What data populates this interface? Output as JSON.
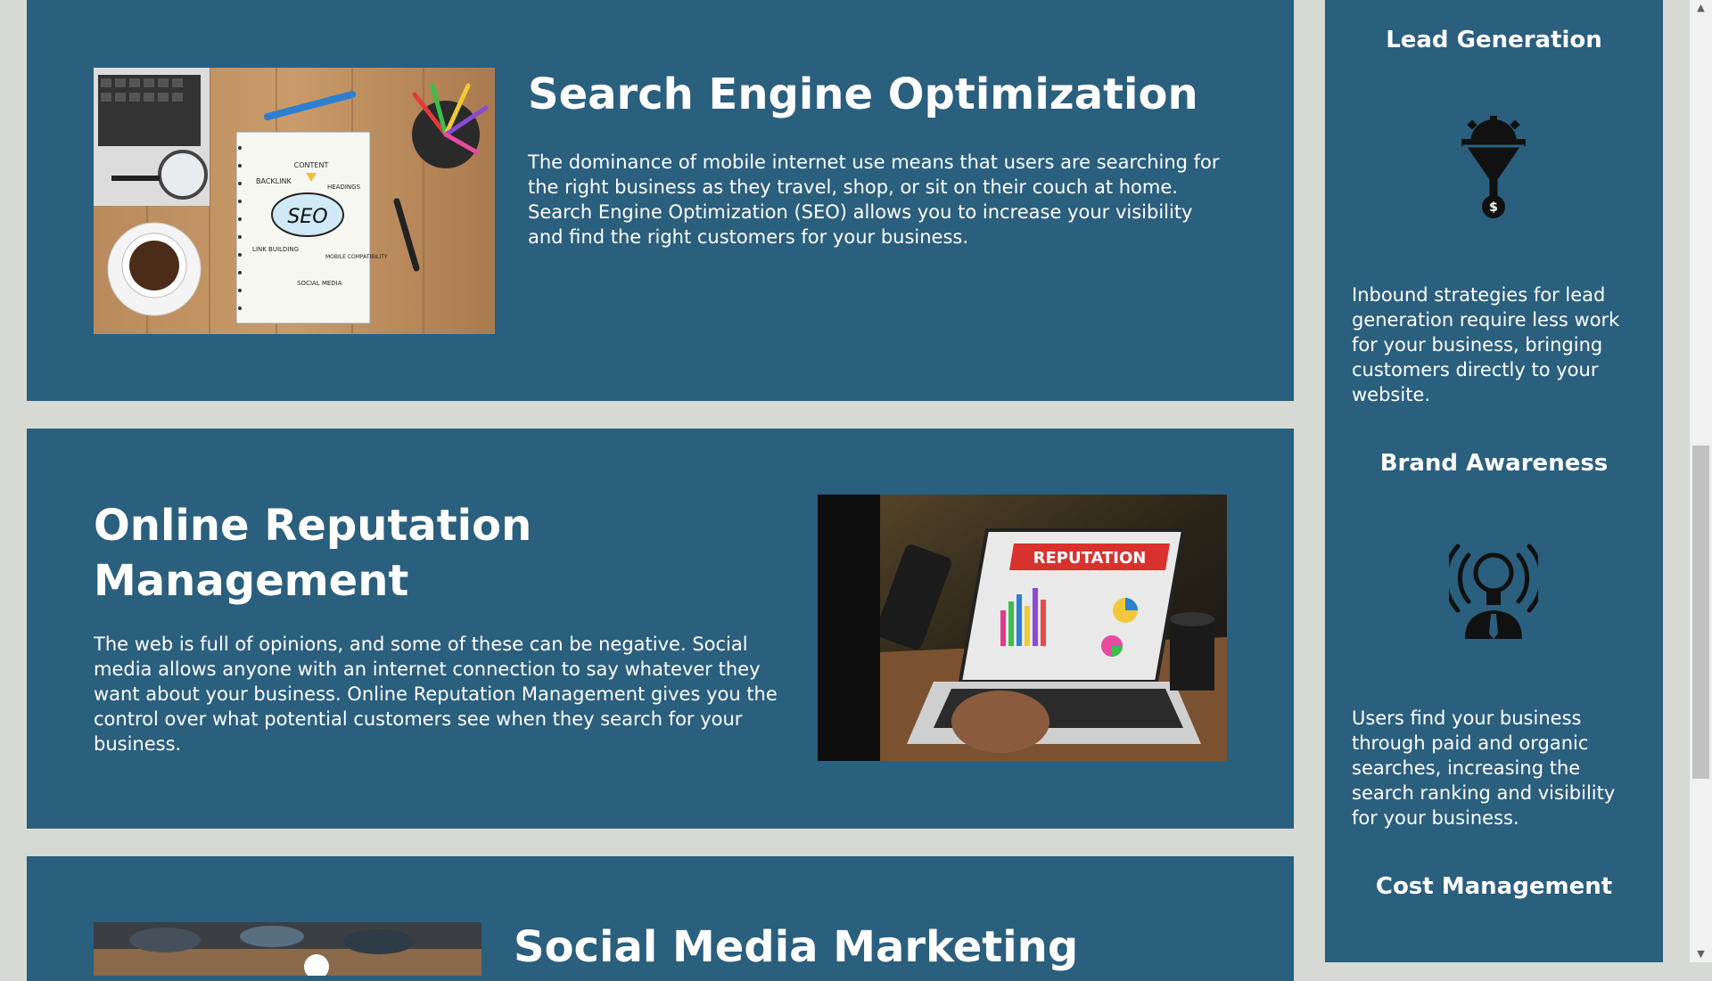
{
  "seo": {
    "title": "Search Engine Optimization",
    "body": "The dominance of mobile internet use means that users are searching for the right business as they travel, shop, or sit on their couch at home. Search Engine Optimization (SEO) allows you to increase your visibility and find the right customers for your business.",
    "image": {
      "center_word": "SEO",
      "labels": [
        "CONTENT",
        "BACKLINK",
        "HEADINGS",
        "LINK BUILDING",
        "MOBILE COMPATIBILITY",
        "SOCIAL MEDIA"
      ]
    }
  },
  "orm": {
    "title_line1": "Online Reputation",
    "title_line2": "Management",
    "body": "The web is full of opinions, and some of these can be negative. Social media allows anyone with an internet connection to say whatever they want about your business. Online Reputation Management gives you the control over what potential customers see when they search for your business.",
    "image": {
      "banner": "REPUTATION"
    }
  },
  "smm": {
    "title": "Social Media Marketing"
  },
  "sidebar": {
    "items": [
      {
        "heading": "Lead Generation",
        "icon": "lead-funnel-icon",
        "text": "Inbound strategies for lead generation require less work for your business, bringing customers directly to your website."
      },
      {
        "heading": "Brand Awareness",
        "icon": "brand-awareness-icon",
        "text": "Users find your business through paid and organic searches, increasing the search ranking and visibility for your business."
      },
      {
        "heading": "Cost Management"
      }
    ]
  },
  "colors": {
    "panel": "#2a5f7e",
    "page_bg": "#d6d9d4",
    "text": "#ffffff"
  }
}
